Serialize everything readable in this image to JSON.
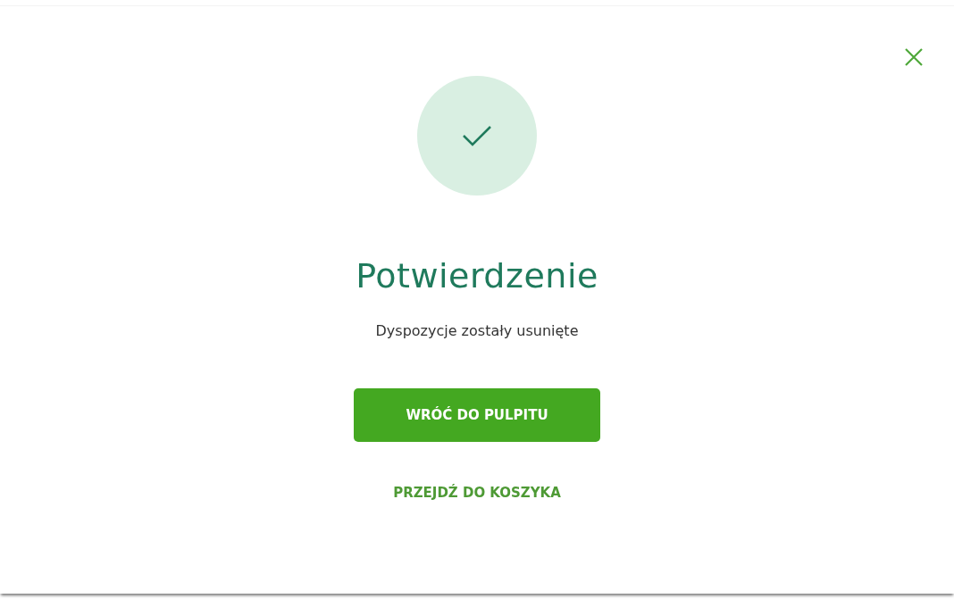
{
  "dialog": {
    "title": "Potwierdzenie",
    "message": "Dyspozycje zostały usunięte",
    "primary_button": "WRÓĆ DO PULPITU",
    "secondary_link": "PRZEJDŹ DO KOSZYKA"
  }
}
